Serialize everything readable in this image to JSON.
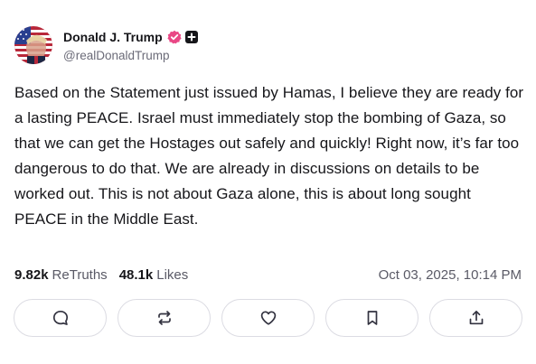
{
  "author": {
    "display_name": "Donald J. Trump",
    "handle": "@realDonaldTrump",
    "avatar_icon": "avatar-flag-portrait",
    "verified_badge_color": "#e94785"
  },
  "post": {
    "text": "Based on the Statement just issued by Hamas, I believe they are ready for a lasting PEACE. Israel must immediately stop the bombing of Gaza, so that we can get the Hostages out safely and quickly! Right now, it’s far too dangerous to do that. We are already in discussions on details to be worked out. This is not about Gaza alone, this is about long sought PEACE in the Middle East."
  },
  "stats": {
    "retruths_count": "9.82k",
    "retruths_label": "ReTruths",
    "likes_count": "48.1k",
    "likes_label": "Likes",
    "timestamp": "Oct 03, 2025, 10:14 PM"
  },
  "actions": [
    {
      "name": "reply",
      "icon": "comment-icon"
    },
    {
      "name": "retruth",
      "icon": "repost-icon"
    },
    {
      "name": "like",
      "icon": "heart-icon"
    },
    {
      "name": "bookmark",
      "icon": "bookmark-icon"
    },
    {
      "name": "share",
      "icon": "share-icon"
    }
  ]
}
